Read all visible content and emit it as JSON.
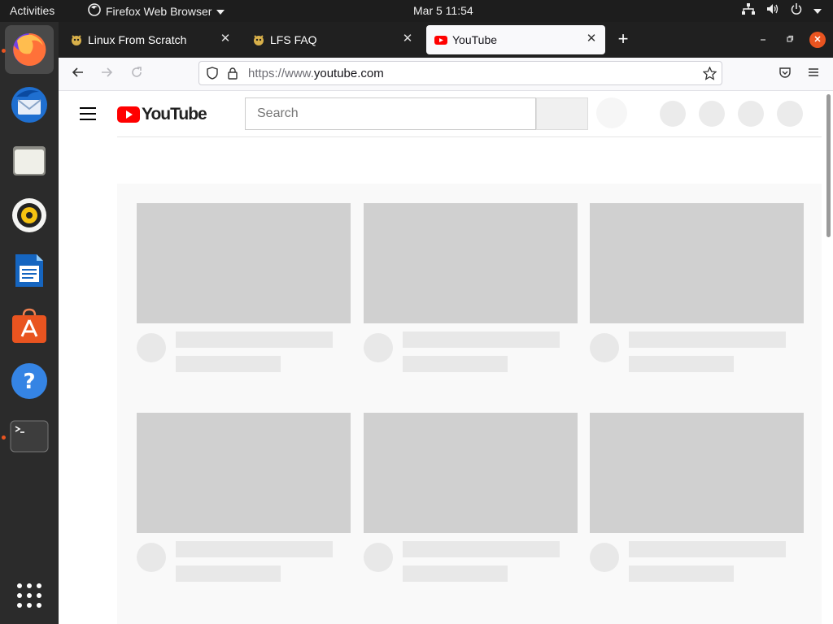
{
  "topbar": {
    "activities": "Activities",
    "app_name": "Firefox Web Browser",
    "clock": "Mar 5  11:54"
  },
  "dock": {
    "items": [
      {
        "name": "firefox",
        "active": true,
        "running": true
      },
      {
        "name": "thunderbird"
      },
      {
        "name": "files"
      },
      {
        "name": "rhythmbox"
      },
      {
        "name": "libreoffice-writer"
      },
      {
        "name": "ubuntu-software"
      },
      {
        "name": "help"
      },
      {
        "name": "terminal",
        "running": true
      }
    ],
    "show_apps": "show-applications"
  },
  "browser": {
    "tabs": [
      {
        "label": "Linux From Scratch",
        "icon": "lfs-favicon",
        "active": false
      },
      {
        "label": "LFS FAQ",
        "icon": "lfs-favicon",
        "active": false
      },
      {
        "label": "YouTube",
        "icon": "youtube-favicon",
        "active": true
      }
    ],
    "url_protocol": "https://www.",
    "url_domain": "youtube.com"
  },
  "youtube": {
    "logo_text": "YouTube",
    "search_placeholder": "Search",
    "grid_rows": 2,
    "grid_cols": 3
  },
  "colors": {
    "accent": "#e95420",
    "youtube_red": "#ff0000",
    "skeleton": "#d0d0d0"
  }
}
